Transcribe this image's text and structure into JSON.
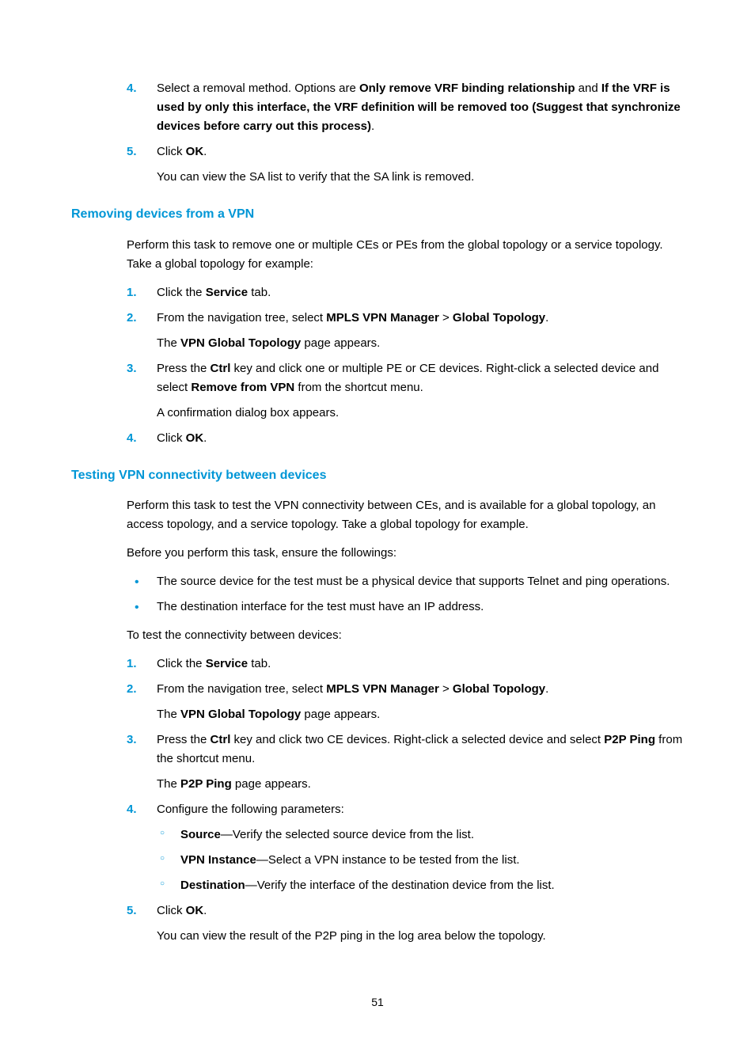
{
  "top_list": {
    "items": [
      {
        "num": "4.",
        "text_pre": "Select a removal method. Options are ",
        "b1": "Only remove VRF binding relationship",
        "mid": " and ",
        "b2": "If the VRF is used by only this interface, the VRF definition will be removed too (Suggest that synchronize devices before carry out this process)",
        "post": "."
      },
      {
        "num": "5.",
        "text_pre": "Click ",
        "b1": "OK",
        "post": ".",
        "sub": "You can view the SA list to verify that the SA link is removed."
      }
    ]
  },
  "section1": {
    "heading": "Removing devices from a VPN",
    "intro": "Perform this task to remove one or multiple CEs or PEs from the global topology or a service topology. Take a global topology for example:",
    "items": [
      {
        "num": "1.",
        "pre": "Click the ",
        "b1": "Service",
        "post": " tab."
      },
      {
        "num": "2.",
        "pre": "From the navigation tree, select ",
        "b1": "MPLS VPN Manager",
        "mid": " > ",
        "b2": "Global Topology",
        "post": ".",
        "sub_pre": "The ",
        "sub_b": "VPN Global Topology",
        "sub_post": " page appears."
      },
      {
        "num": "3.",
        "pre": "Press the ",
        "b1": "Ctrl",
        "mid": " key and click one or multiple PE or CE devices. Right-click a selected device and select ",
        "b2": "Remove from VPN",
        "post": " from the shortcut menu.",
        "sub": "A confirmation dialog box appears."
      },
      {
        "num": "4.",
        "pre": "Click ",
        "b1": "OK",
        "post": "."
      }
    ]
  },
  "section2": {
    "heading": "Testing VPN connectivity between devices",
    "intro": "Perform this task to test the VPN connectivity between CEs, and is available for a global topology, an access topology, and a service topology. Take a global topology for example.",
    "before": "Before you perform this task, ensure the followings:",
    "bullets": [
      "The source device for the test must be a physical device that supports Telnet and ping operations.",
      "The destination interface for the test must have an IP address."
    ],
    "totest": "To test the connectivity between devices:",
    "items": [
      {
        "num": "1.",
        "pre": "Click the ",
        "b1": "Service",
        "post": " tab."
      },
      {
        "num": "2.",
        "pre": "From the navigation tree, select ",
        "b1": "MPLS VPN Manager",
        "mid": " > ",
        "b2": "Global Topology",
        "post": ".",
        "sub_pre": "The ",
        "sub_b": "VPN Global Topology",
        "sub_post": " page appears."
      },
      {
        "num": "3.",
        "pre": "Press the ",
        "b1": "Ctrl",
        "mid": " key and click two CE devices. Right-click a selected device and select ",
        "b2": "P2P Ping",
        "post": " from the shortcut menu.",
        "sub_pre": "The ",
        "sub_b": "P2P Ping",
        "sub_post": " page appears."
      },
      {
        "num": "4.",
        "text": "Configure the following parameters:",
        "sublist": [
          {
            "b": "Source",
            "rest": "—Verify the selected source device from the list."
          },
          {
            "b": "VPN Instance",
            "rest": "—Select a VPN instance to be tested from the list."
          },
          {
            "b": "Destination",
            "rest": "—Verify the interface of the destination device from the list."
          }
        ]
      },
      {
        "num": "5.",
        "pre": "Click ",
        "b1": "OK",
        "post": ".",
        "sub": "You can view the result of the P2P ping in the log area below the topology."
      }
    ]
  },
  "page_number": "51"
}
